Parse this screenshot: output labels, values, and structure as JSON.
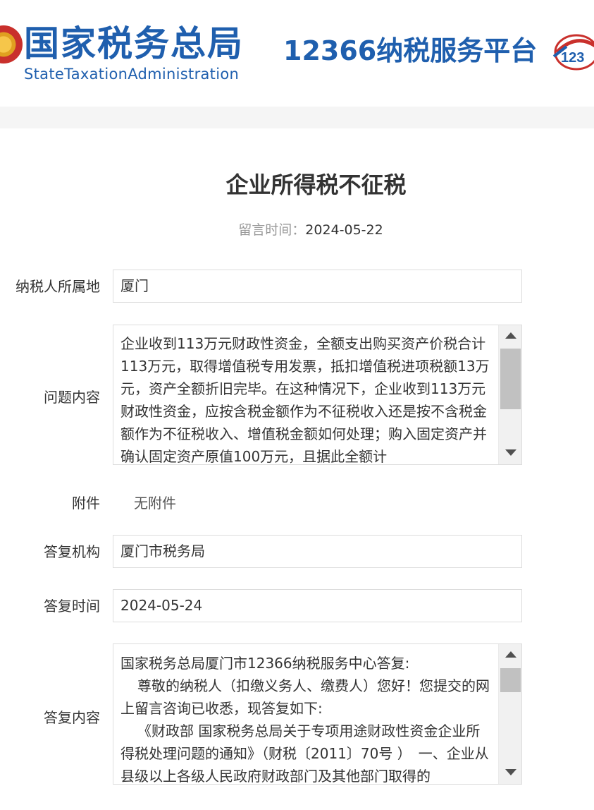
{
  "header": {
    "brand_cn": "国家税务总局",
    "brand_en": "StateTaxationAdministration",
    "platform": "12366纳税服务平台",
    "badge_icon": "12366-badge-icon",
    "brand_color": "#1f5fae"
  },
  "article": {
    "title": "企业所得税不征税",
    "time_label": "留言时间：",
    "time_value": "2024-05-22"
  },
  "form": {
    "location_label": "纳税人所属地",
    "location_value": "厦门",
    "question_label": "问题内容",
    "question_text": "企业收到113万元财政性资金，全额支出购买资产价税合计113万元，取得增值税专用发票，抵扣增值税进项税额13万元，资产全额折旧完毕。在这种情况下，企业收到113万元财政性资金，应按含税金额作为不征税收入还是按不含税金额作为不征税收入、增值税金额如何处理；购入固定资产并确认固定资产原值100万元，且据此全额计",
    "attachment_label": "附件",
    "attachment_value": "无附件",
    "reply_org_label": "答复机构",
    "reply_org_value": "厦门市税务局",
    "reply_time_label": "答复时间",
    "reply_time_value": "2024-05-24",
    "reply_content_label": "答复内容",
    "reply_line1": "国家税务总局厦门市12366纳税服务中心答复:",
    "reply_line2": "尊敬的纳税人（扣缴义务人、缴费人）您好！您提交的网上留言咨询已收悉，现答复如下:",
    "reply_line3": "《财政部 国家税务总局关于专项用途财政性资金企业所得税处理问题的通知》（财税〔2011〕70号 ）　一、企业从县级以上各级人民政府财政部门及其他部门取得的"
  }
}
